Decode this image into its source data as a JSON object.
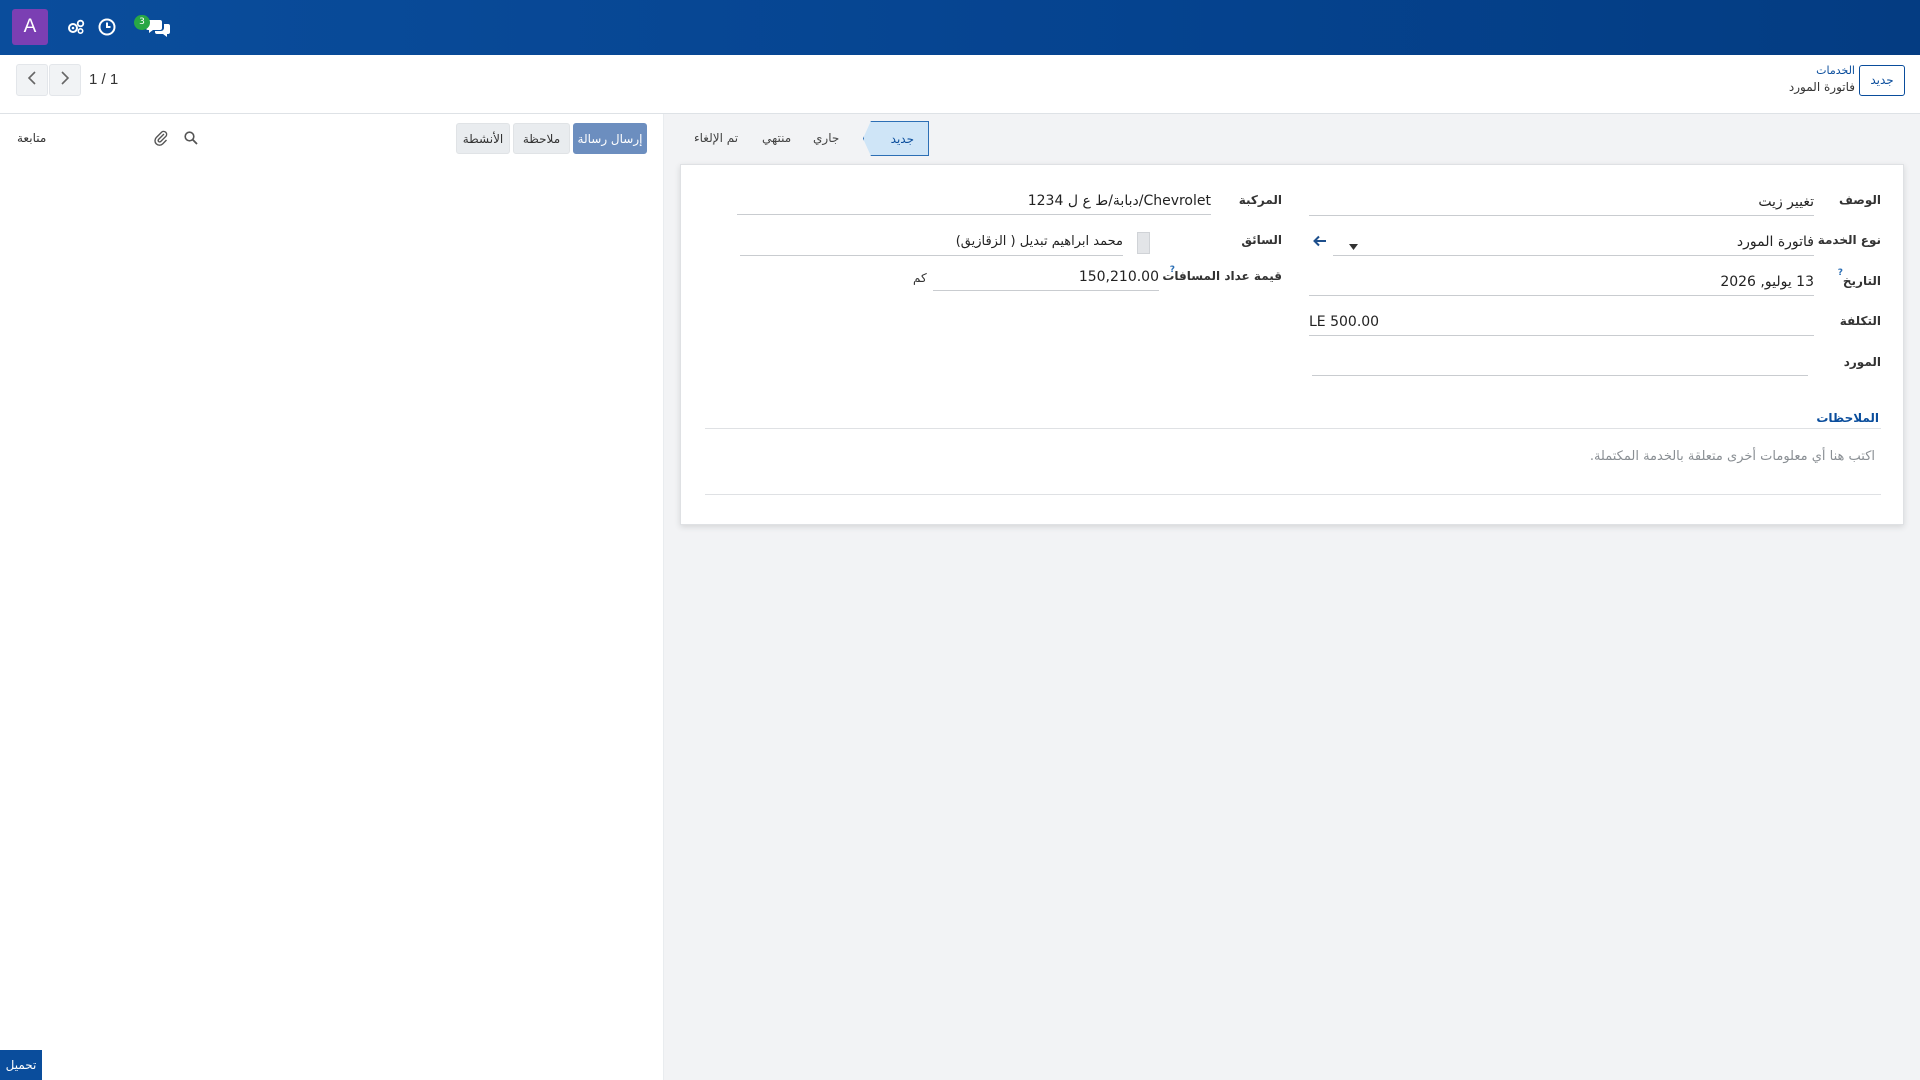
{
  "navbar": {
    "avatar_letter": "A",
    "chat_badge": "3",
    "icons": [
      "debug-icon",
      "clock-icon",
      "chat-icon"
    ]
  },
  "controlbar": {
    "new_label": "جديد",
    "breadcrumb_parent": "الخدمات",
    "breadcrumb_current": "فاتورة المورد",
    "pager_value": "1 / 1"
  },
  "chatter": {
    "send_message": "إرسال رسالة",
    "log_note": "ملاحظة",
    "activities": "الأنشطة",
    "follow": "متابعة",
    "upload": "تحميل"
  },
  "statusbar": {
    "stages": [
      "جديد",
      "جاري",
      "منتهي",
      "تم الإلغاء"
    ],
    "active": "جديد"
  },
  "form": {
    "description_label": "الوصف",
    "description_value": "تغيير زيت",
    "service_type_label": "نوع الخدمة",
    "service_type_value": "فاتورة المورد",
    "date_label": "التاريخ",
    "date_value": "13 يوليو, 2026",
    "cost_label": "التكلفة",
    "cost_value": "LE 500.00",
    "vendor_label": "المورد",
    "vendor_value": "",
    "vehicle_label": "المركبة",
    "vehicle_value": "Chevrolet/دبابة/ط ع ل 1234",
    "driver_label": "السائق",
    "driver_value": "محمد ابراهيم تبديل ( الزقازيق)",
    "odometer_label": "قيمة عداد المسافات",
    "odometer_value": "150,210.00",
    "odometer_unit": "كم",
    "help_mark": "?",
    "notes_tab": "الملاحظات",
    "notes_placeholder": "اكتب هنا أي معلومات أخرى متعلقة بالخدمة المكتملة."
  },
  "colors": {
    "navbar": "#0a4d9c",
    "avatar": "#7b3fb3",
    "badge": "#28a745",
    "primary_button": "#6c8ebf",
    "active_stage": "#cfe5f7"
  }
}
